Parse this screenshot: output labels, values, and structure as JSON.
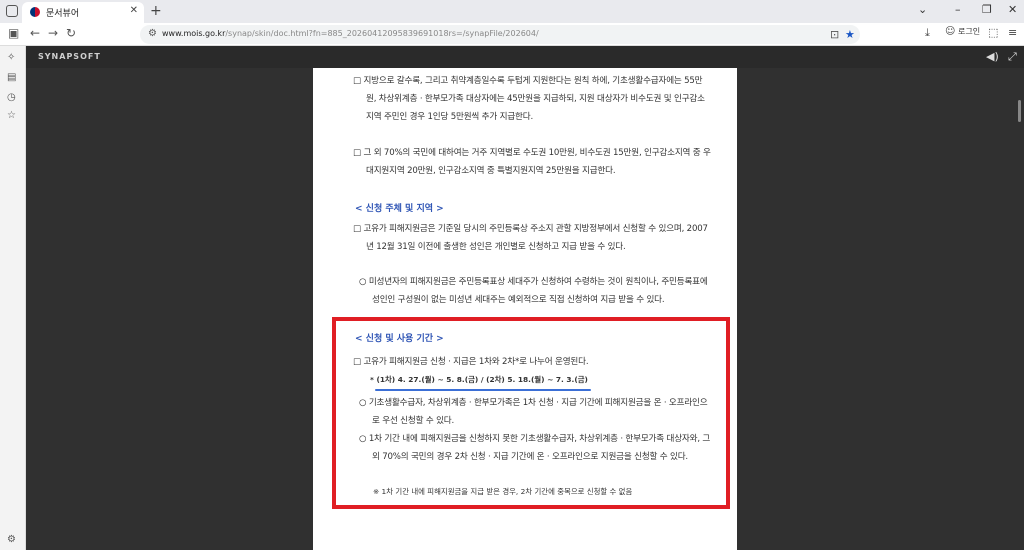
{
  "browser": {
    "tab_title": "문서뷰어",
    "tab_close": "✕",
    "new_tab": "+",
    "url_host": "www.mois.go.kr",
    "url_path": "/synap/skin/doc.html?fn=885_20260412095839691018rs=/synapFile/202604/",
    "login_label": "로그인",
    "window_controls": [
      "⌄",
      "–",
      "❐",
      "✕"
    ]
  },
  "viewer": {
    "brand": "SYNAPSOFT"
  },
  "document": {
    "para1": "□ 지방으로 갈수록, 그리고 취약계층일수록 두텁게 지원한다는 원칙 하에, 기초생활수급자에는 55만원, 차상위계층 · 한부모가족 대상자에는 45만원을 지급하되, 지원 대상자가 비수도권 및 인구감소지역 주민인 경우 1인당 5만원씩 추가 지급한다.",
    "para2": "□ 그 외 70%의 국민에 대하여는 거주 지역별로 수도권 10만원, 비수도권 15만원, 인구감소지역 중 우대지원지역 20만원, 인구감소지역 중 특별지원지역 25만원을 지급한다.",
    "section1": "< 신청 주체 및 지역 >",
    "para3": "□ 고유가 피해지원금은 기준일 당시의 주민등록상 주소지 관할 지방정부에서 신청할 수 있으며, 2007년 12월 31일 이전에 출생한 성인은 개인별로 신청하고 지급 받을 수 있다.",
    "para4": "○ 미성년자의 피해지원금은 주민등록표상 세대주가 신청하여 수령하는 것이 원칙이나, 주민등록표에 성인인 구성원이 없는 미성년 세대주는 예외적으로 직접 신청하여 지급 받을 수 있다.",
    "section2": "< 신청 및 사용 기간 >",
    "para5": "□ 고유가 피해지원금 신청 · 지급은 1차와 2차*로 나누어 운영된다.",
    "note_schedule": "* (1차) 4. 27.(월) ~ 5. 8.(금) / (2차) 5. 18.(월) ~ 7. 3.(금)",
    "para6": "○ 기초생활수급자, 차상위계층 · 한부모가족은 1차 신청 · 지급 기간에 피해지원금을 온 · 오프라인으로 우선 신청할 수 있다.",
    "para7": "○ 1차 기간 내에 피해지원금을 신청하지 못한 기초생활수급자, 차상위계층 · 한부모가족 대상자와, 그 외 70%의 국민의 경우 2차 신청 · 지급 기간에 온 · 오프라인으로 지원금을 신청할 수 있다.",
    "footnote": "※ 1차 기간 내에 피해지원금을 지급 받은 경우, 2차 기간에 중복으로 신청할 수 없음"
  },
  "colors": {
    "highlight_box": "#e01e24",
    "underline": "#3b6fd6",
    "section_heading": "#2f55b5"
  }
}
